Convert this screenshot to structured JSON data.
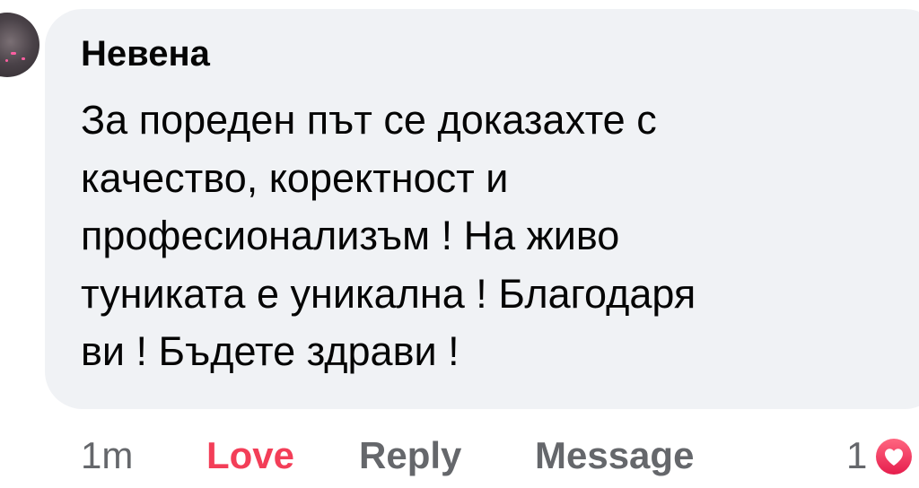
{
  "comment": {
    "author": "Невена",
    "text_lines": [
      "За пореден път се доказахте с",
      "качество, коректност и",
      "професионализъм ! На живо",
      "туниката е уникална ! Благодаря",
      "ви ! Бъдете здрави !"
    ]
  },
  "actions": {
    "time": "1m",
    "love": "Love",
    "reply": "Reply",
    "message": "Message"
  },
  "reactions": {
    "count": "1",
    "icon": "heart-icon"
  },
  "colors": {
    "bubble_bg": "#f0f2f5",
    "love": "#f33e58",
    "secondary_text": "#65676b",
    "primary_text": "#050505"
  }
}
